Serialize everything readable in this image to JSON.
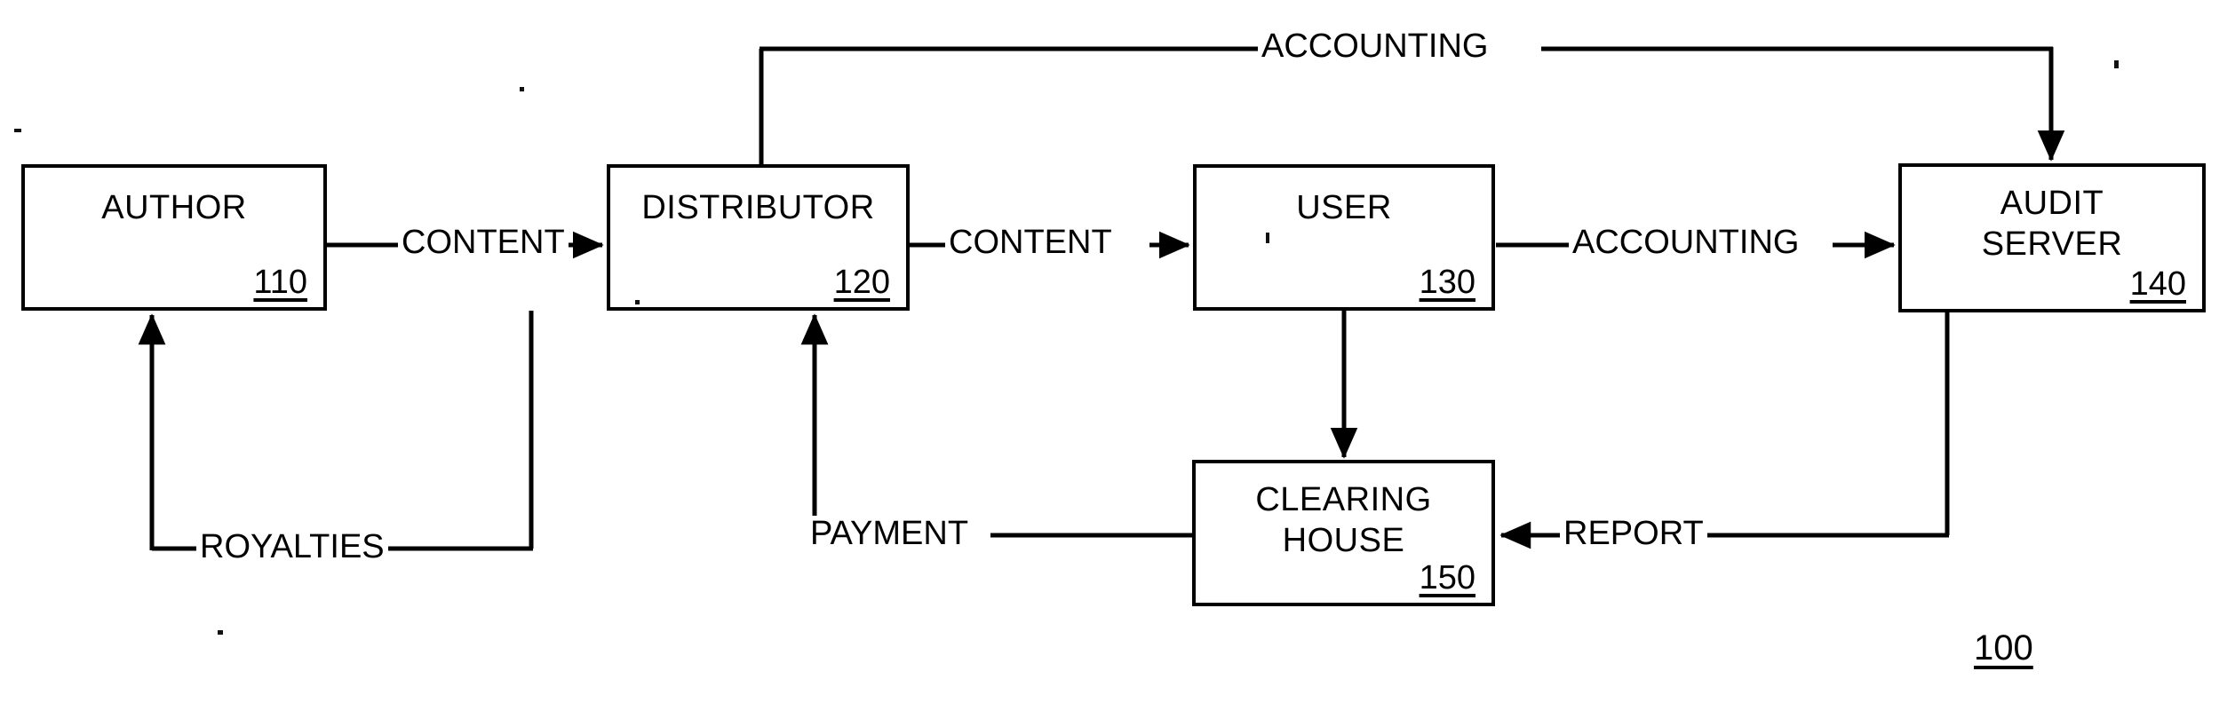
{
  "figure": {
    "reference_numeral": "100",
    "background_color": "#ffffff",
    "line_color": "#000000"
  },
  "nodes": [
    {
      "id": "author",
      "title": "AUTHOR",
      "ref": "110"
    },
    {
      "id": "distributor",
      "title": "DISTRIBUTOR",
      "ref": "120"
    },
    {
      "id": "user",
      "title": "USER",
      "ref": "130"
    },
    {
      "id": "audit_server",
      "title": "AUDIT\nSERVER",
      "ref": "140"
    },
    {
      "id": "clearing_house",
      "title": "CLEARING\nHOUSE",
      "ref": "150"
    }
  ],
  "edges": [
    {
      "id": "author_to_distributor",
      "label": "CONTENT",
      "from": "author",
      "to": "distributor"
    },
    {
      "id": "distributor_to_user",
      "label": "CONTENT",
      "from": "distributor",
      "to": "user"
    },
    {
      "id": "user_to_audit_server",
      "label": "ACCOUNTING",
      "from": "user",
      "to": "audit_server"
    },
    {
      "id": "distributor_to_audit_server",
      "label": "ACCOUNTING",
      "from": "distributor",
      "to": "audit_server"
    },
    {
      "id": "distributor_to_author",
      "label": "ROYALTIES",
      "from": "distributor",
      "to": "author"
    },
    {
      "id": "clearing_house_to_distributor",
      "label": "PAYMENT",
      "from": "clearing_house",
      "to": "distributor"
    },
    {
      "id": "audit_server_to_clearing_house",
      "label": "REPORT",
      "from": "audit_server",
      "to": "clearing_house"
    },
    {
      "id": "user_to_clearing_house",
      "label": "",
      "from": "user",
      "to": "clearing_house"
    }
  ]
}
